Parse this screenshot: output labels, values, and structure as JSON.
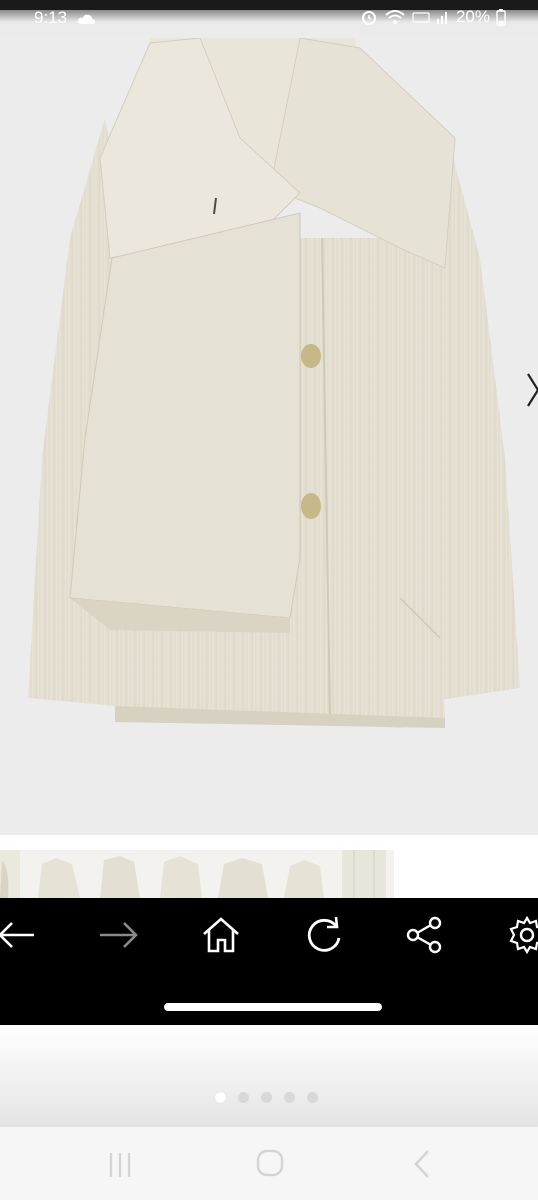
{
  "status_bar": {
    "time": "9:13",
    "battery_percent": "20%",
    "icons": [
      "cloud-icon",
      "alarm-icon",
      "wifi-icon",
      "volte-icon",
      "signal-icon",
      "battery-icon"
    ]
  },
  "product": {
    "image_subject": "cream-coat-image",
    "colors": {
      "coat": "#e7e3d7",
      "coat_shadow": "#d6d1c1",
      "button": "#c9b98a",
      "background": "#ececec"
    }
  },
  "thumbnails": {
    "count": 7
  },
  "browser_nav": {
    "buttons": [
      "back-arrow-icon",
      "forward-arrow-icon",
      "home-icon",
      "refresh-icon",
      "share-icon",
      "settings-icon"
    ]
  },
  "carousel": {
    "dot_count": 5,
    "active_index": 0
  },
  "android_nav": {
    "buttons": [
      "recents-icon",
      "home-circle-icon",
      "back-chevron-icon"
    ]
  }
}
